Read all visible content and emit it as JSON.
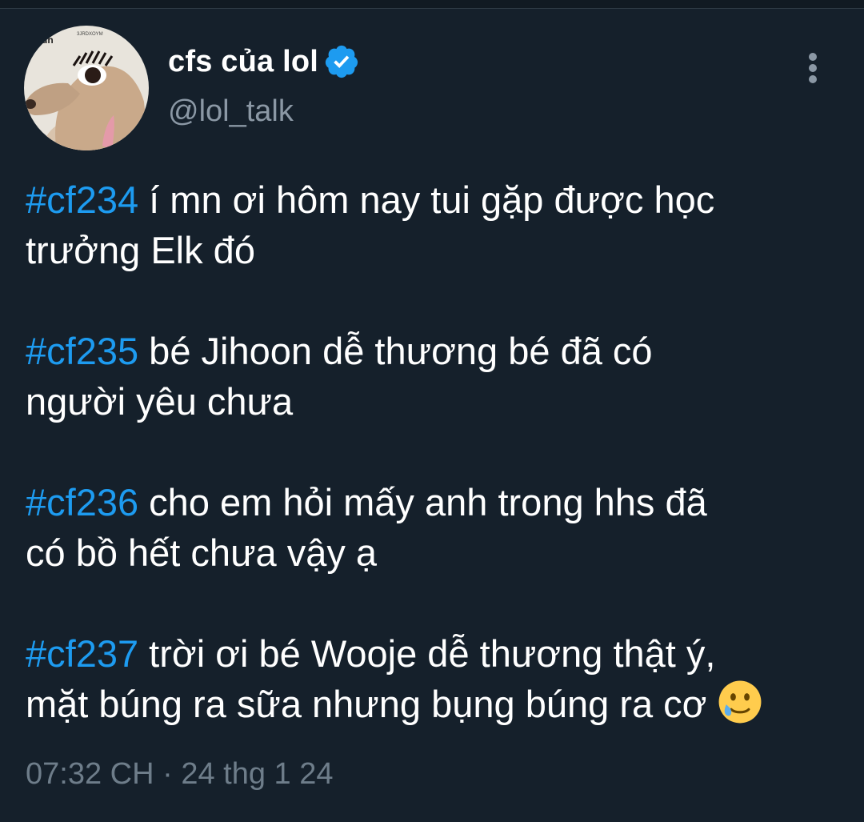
{
  "tweet": {
    "author": {
      "display_name": "cfs của lol",
      "handle": "@lol_talk",
      "verified": true,
      "avatar_icon": "dog-with-eyelashes-avatar"
    },
    "paragraphs": [
      {
        "hashtag": "#cf234",
        "text": " í mn ơi hôm nay tui gặp được học\ntrưởng Elk đó"
      },
      {
        "hashtag": "#cf235",
        "text": " bé Jihoon dễ thương bé đã có\nngười yêu chưa"
      },
      {
        "hashtag": "#cf236",
        "text": " cho em hỏi mấy anh trong hhs đã\ncó bồ hết chưa vậy ạ"
      },
      {
        "hashtag": "#cf237",
        "text": " trời ơi bé Wooje dễ thương thật ý,\nmặt búng ra sữa nhưng bụng búng ra cơ "
      }
    ],
    "trailing_emoji": "smiling-face-with-tear-emoji",
    "time": "07:32 CH",
    "separator": " · ",
    "date": "24 thg 1 24"
  },
  "colors": {
    "background": "#15202b",
    "hashtag": "#1d9bf0",
    "secondary_text": "#8b98a5",
    "verified_badge": "#1d9bf0"
  }
}
